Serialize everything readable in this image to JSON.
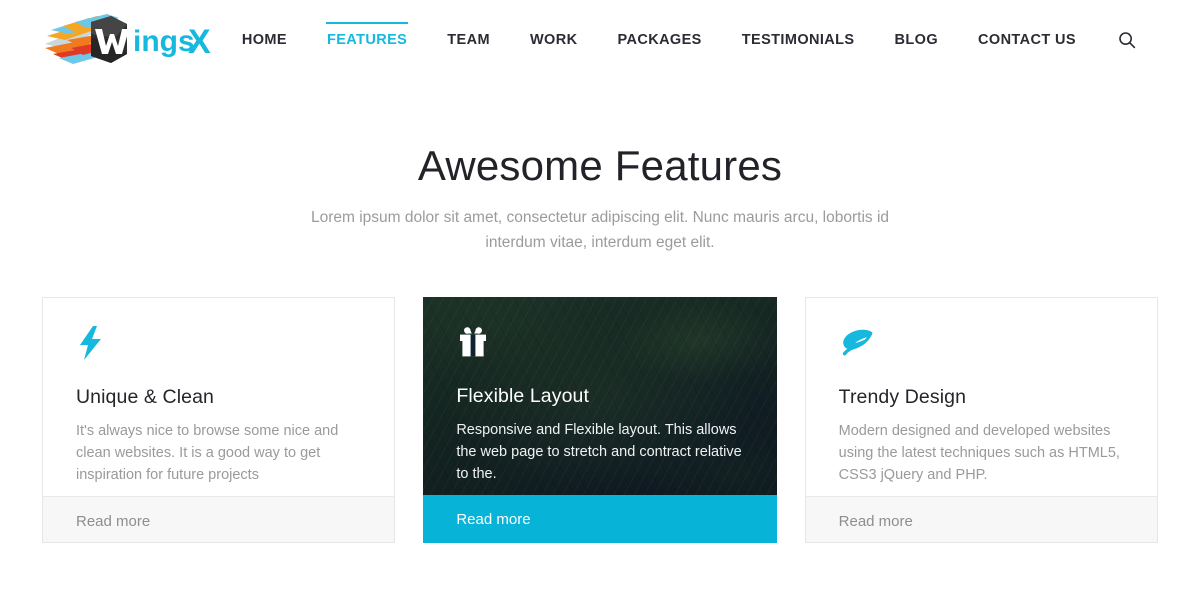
{
  "brand": {
    "name_part1": "W",
    "name_part2": "ings",
    "name_part3": "X",
    "full_name": "WingsX",
    "accent_color": "#16b8de",
    "logo_colors": [
      "#f07b1e",
      "#f5a623",
      "#e03a27",
      "#6ec6e8",
      "#c9d7de",
      "#3a3a3a"
    ]
  },
  "nav": {
    "items": [
      {
        "label": "HOME",
        "active": false
      },
      {
        "label": "FEATURES",
        "active": true
      },
      {
        "label": "TEAM",
        "active": false
      },
      {
        "label": "WORK",
        "active": false
      },
      {
        "label": "PACKAGES",
        "active": false
      },
      {
        "label": "TESTIMONIALS",
        "active": false
      },
      {
        "label": "BLOG",
        "active": false
      },
      {
        "label": "CONTACT US",
        "active": false
      }
    ],
    "search_icon": "search-icon"
  },
  "section": {
    "title": "Awesome Features",
    "subtitle": "Lorem ipsum dolor sit amet, consectetur adipiscing elit. Nunc mauris arcu, lobortis id interdum vitae, interdum eget elit."
  },
  "cards": [
    {
      "icon": "lightning-bolt-icon",
      "icon_color": "#16b8de",
      "title": "Unique & Clean",
      "text": "It's always nice to browse some nice and clean websites. It is a good way to get inspiration for future projects",
      "read_more": "Read more",
      "featured": false
    },
    {
      "icon": "gift-icon",
      "icon_color": "#ffffff",
      "title": "Flexible Layout",
      "text": "Responsive and Flexible layout. This allows the web page to stretch and contract relative to the.",
      "read_more": "Read more",
      "featured": true,
      "footer_color": "#07b4d8"
    },
    {
      "icon": "leaf-icon",
      "icon_color": "#16b8de",
      "title": "Trendy Design",
      "text": "Modern designed and developed websites using the latest techniques such as HTML5, CSS3 jQuery and PHP.",
      "read_more": "Read more",
      "featured": false
    }
  ]
}
